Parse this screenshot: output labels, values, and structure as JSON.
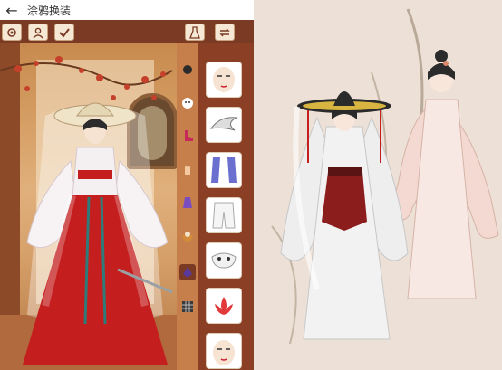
{
  "app": {
    "title": "涂鸦换装",
    "back_icon": "back-arrow-icon"
  },
  "toolbar": {
    "left_buttons": [
      "settings-icon",
      "avatar-icon",
      "checkmark-icon"
    ],
    "right_buttons": [
      "dress-icon",
      "swap-icon"
    ]
  },
  "categories": [
    {
      "name": "hair",
      "icon": "hair-icon"
    },
    {
      "name": "face",
      "icon": "face-icon"
    },
    {
      "name": "boots",
      "icon": "boot-icon"
    },
    {
      "name": "hands",
      "icon": "hand-icon"
    },
    {
      "name": "robe",
      "icon": "robe-icon"
    },
    {
      "name": "food",
      "icon": "bowl-icon"
    },
    {
      "name": "accessory",
      "icon": "accessory-icon",
      "active": true
    },
    {
      "name": "pattern",
      "icon": "pattern-icon"
    }
  ],
  "items": [
    {
      "name": "face-item-1",
      "icon": "face-item-icon"
    },
    {
      "name": "wing-item",
      "icon": "wing-item-icon"
    },
    {
      "name": "sleeve-item",
      "icon": "sleeve-item-icon"
    },
    {
      "name": "pants-item",
      "icon": "pants-item-icon"
    },
    {
      "name": "mask-item",
      "icon": "mask-item-icon"
    },
    {
      "name": "lotus-item",
      "icon": "lotus-item-icon"
    },
    {
      "name": "face-item-2",
      "icon": "face-item-icon"
    }
  ],
  "colors": {
    "toolbar": "#7a3a24",
    "panel": "#8b3f25",
    "category_column": "#c67e4a",
    "accent_red": "#c41e1e",
    "artwork_bg": "#ede1d7"
  }
}
